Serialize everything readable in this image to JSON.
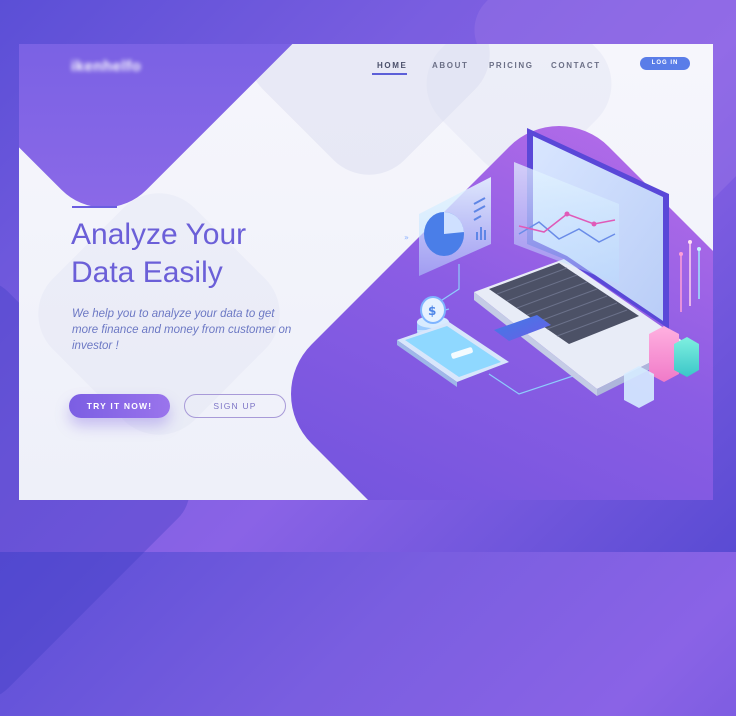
{
  "brand": {
    "logo_text": "ikenhelfo"
  },
  "nav": {
    "items": [
      {
        "label": "HOME",
        "active": true
      },
      {
        "label": "ABOUT",
        "active": false
      },
      {
        "label": "PRICING",
        "active": false
      },
      {
        "label": "CONTACT",
        "active": false
      }
    ],
    "login_label": "LOG IN"
  },
  "hero": {
    "title": "Analyze Your\nData Easily",
    "description": "We help you to analyze your data to get more finance and money from customer on investor !",
    "primary_cta": "TRY IT NOW!",
    "secondary_cta": "SIGN UP"
  },
  "illustration": {
    "coin_symbol": "$",
    "icons": [
      "laptop-icon",
      "pie-chart-icon",
      "line-chart-icon",
      "coin-stack-icon",
      "smartphone-icon",
      "bar-chart-icon"
    ]
  },
  "colors": {
    "accent": "#6b5fd8",
    "cta_start": "#7b5ee3",
    "cta_end": "#9a74ec",
    "login_bg": "#5a7de8",
    "background": "#6a56dc"
  }
}
